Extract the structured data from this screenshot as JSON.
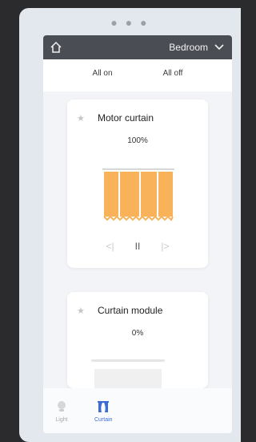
{
  "header": {
    "room_name": "Bedroom"
  },
  "quick_actions": {
    "all_on": "All on",
    "all_off": "All off"
  },
  "cards": [
    {
      "title": "Motor curtain",
      "percent": "100%"
    },
    {
      "title": "Curtain module",
      "percent": "0%"
    }
  ],
  "tabs": [
    {
      "label": "Light"
    },
    {
      "label": "Curtain"
    }
  ],
  "colors": {
    "curtain_fill": "#f7b25a",
    "accent": "#3f6bd6",
    "topbar": "#4a4d53"
  }
}
